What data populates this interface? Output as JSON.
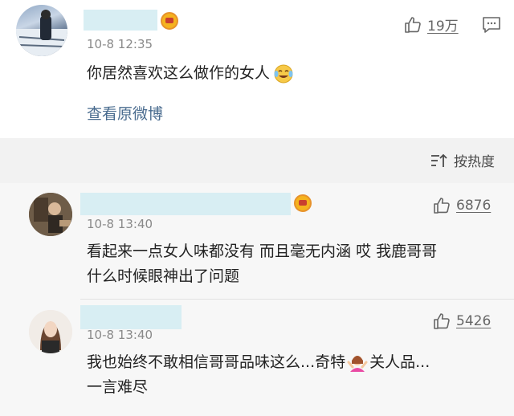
{
  "post": {
    "time": "10-8 12:35",
    "like_count": "19万",
    "text": "你居然喜欢这么做作的女人",
    "emoji_icon": "crying-laughing-emoji-icon",
    "view_original": "查看原微博"
  },
  "sort": {
    "label": "按热度"
  },
  "comments": [
    {
      "time": "10-8 13:40",
      "like_count": "6876",
      "text_line1": "看起来一点女人味都没有 而且毫无内涵 哎 我鹿哥哥",
      "text_line2": "什么时候眼神出了问题",
      "vip": true
    },
    {
      "time": "10-8 13:40",
      "like_count": "5426",
      "text_line1a": "我也始终不敢相信哥哥品味这么...奇特",
      "text_line1b": "关人品...",
      "text_line2": "一言难尽",
      "emoji_icon": "shrugging-woman-emoji-icon",
      "vip": false
    }
  ],
  "colors": {
    "link": "#4a6c8f",
    "name_redaction": "#d8eef3",
    "background": "#f2f2f2"
  }
}
